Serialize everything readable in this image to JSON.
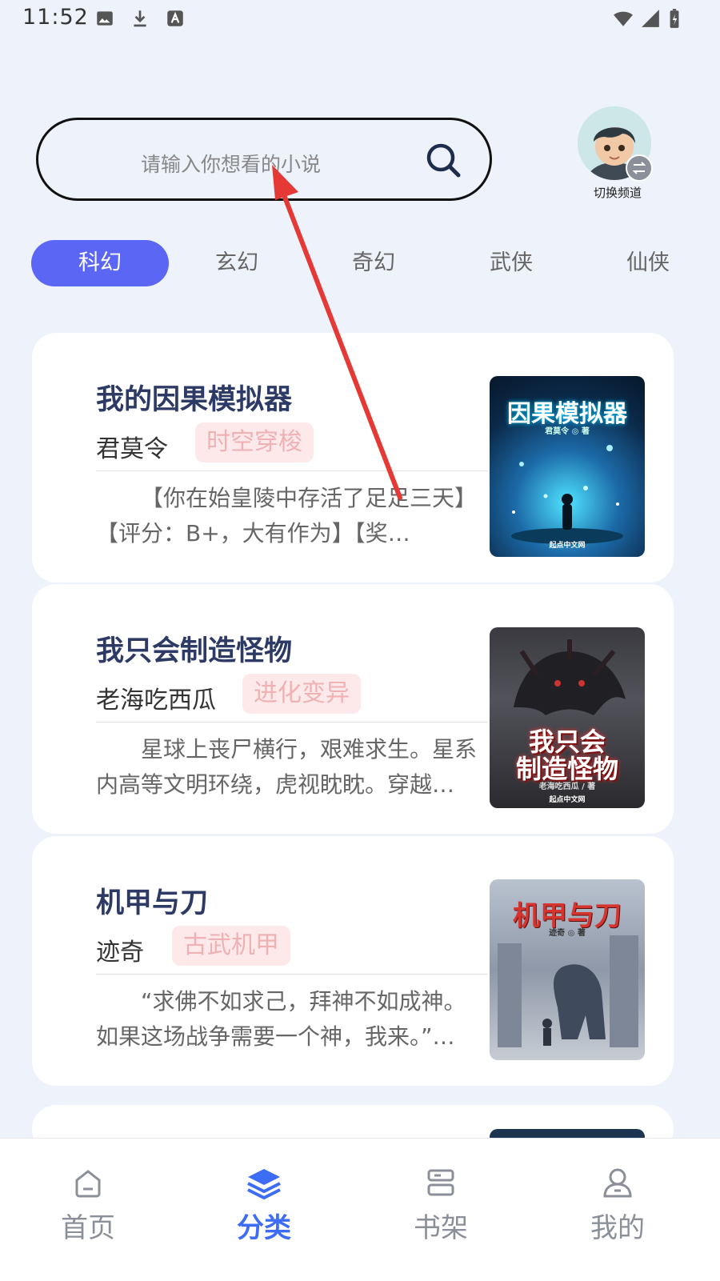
{
  "status_bar": {
    "time": "11:52"
  },
  "search": {
    "placeholder": "请输入你想看的小说"
  },
  "channel": {
    "label": "切换频道"
  },
  "tabs": [
    {
      "label": "科幻",
      "active": true
    },
    {
      "label": "玄幻",
      "active": false
    },
    {
      "label": "奇幻",
      "active": false
    },
    {
      "label": "武侠",
      "active": false
    },
    {
      "label": "仙侠",
      "active": false
    }
  ],
  "books": [
    {
      "title": "我的因果模拟器",
      "author": "君莫令",
      "tag": "时空穿梭",
      "desc": "【你在始皇陵中存活了足足三天】【评分：B+，大有作为】【奖…",
      "cover_title": "因果模拟器",
      "cover_author": "君莫令 ◎ 著",
      "cover_publisher": "起点中文网"
    },
    {
      "title": "我只会制造怪物",
      "author": "老海吃西瓜",
      "tag": "进化变异",
      "desc": "星球上丧尸横行，艰难求生。星系内高等文明环绕，虎视眈眈。穿越…",
      "cover_title_1": "我只会",
      "cover_title_2": "制造怪物",
      "cover_author": "老海吃西瓜 / 著",
      "cover_publisher": "起点中文网"
    },
    {
      "title": "机甲与刀",
      "author": "迹奇",
      "tag": "古武机甲",
      "desc": "“求佛不如求己，拜神不如成神。如果这场战争需要一个神，我来。”…",
      "cover_title": "机甲与刀",
      "cover_author": "迹奇 ◎ 著"
    }
  ],
  "bottom_nav": [
    {
      "label": "首页",
      "icon": "home-icon",
      "active": false
    },
    {
      "label": "分类",
      "icon": "layers-icon",
      "active": true
    },
    {
      "label": "书架",
      "icon": "bookshelf-icon",
      "active": false
    },
    {
      "label": "我的",
      "icon": "user-icon",
      "active": false
    }
  ],
  "colors": {
    "accent": "#5b66f5",
    "nav_active": "#3d6df5",
    "tag_bg": "#fde9ea",
    "tag_text": "#efb1b3",
    "annotation_arrow": "#e53935"
  }
}
